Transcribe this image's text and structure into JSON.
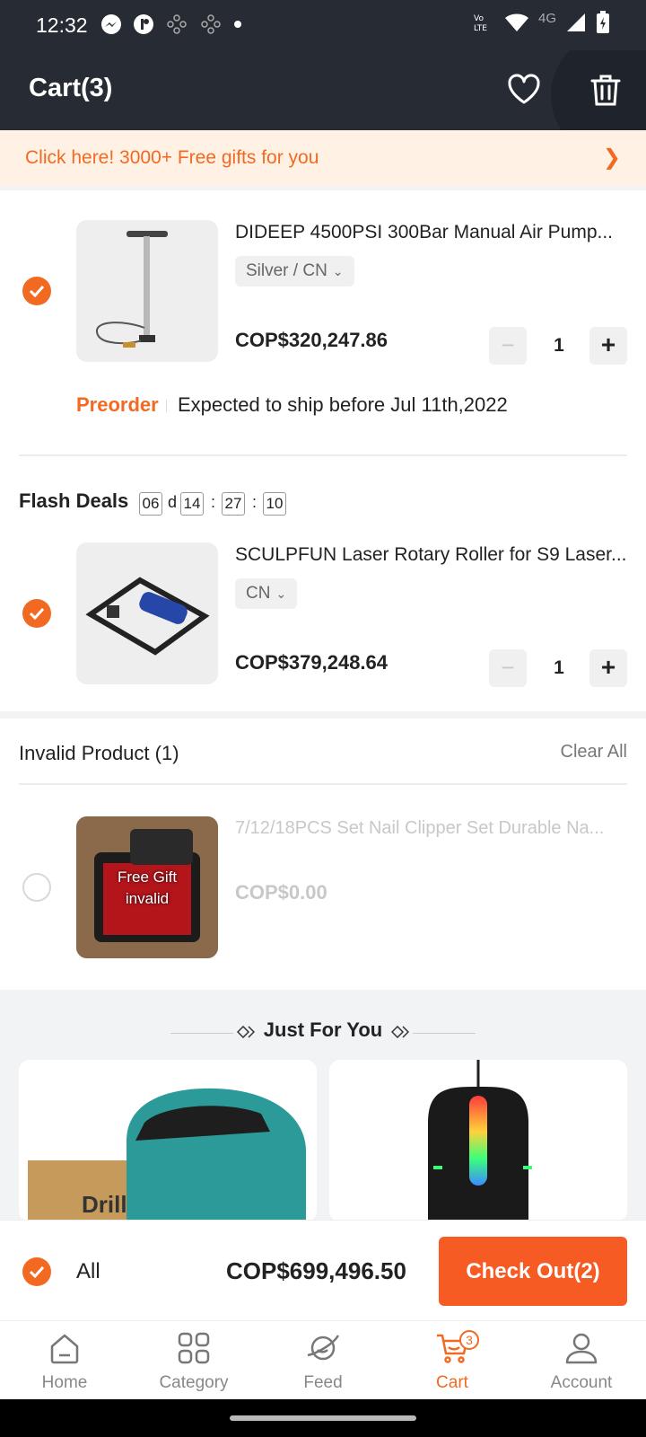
{
  "status_bar": {
    "time": "12:32",
    "network": "4G"
  },
  "header": {
    "title": "Cart(3)"
  },
  "gift_banner": {
    "text": "Click here! 3000+ Free gifts for you"
  },
  "cart_items": [
    {
      "name": "DIDEEP 4500PSI 300Bar Manual Air Pump...",
      "variant": "Silver / CN",
      "price": "COP$320,247.86",
      "qty": "1",
      "preorder_label": "Preorder",
      "ship_note": "Expected to ship before Jul 11th,2022"
    },
    {
      "name": "SCULPFUN Laser Rotary Roller for S9 Laser...",
      "variant": "CN",
      "price": "COP$379,248.64",
      "qty": "1"
    }
  ],
  "flash_deals": {
    "title": "Flash Deals",
    "days": "06",
    "d_label": "d",
    "hours": "14",
    "minutes": "27",
    "seconds": "10",
    "sep": ":"
  },
  "invalid": {
    "title": "Invalid Product (1)",
    "clear_all": "Clear All",
    "item": {
      "name": "7/12/18PCS Set Nail Clipper Set Durable Na...",
      "price": "COP$0.00",
      "overlay_line1": "Free Gift",
      "overlay_line2": "invalid"
    }
  },
  "just_for_you": {
    "title": "Just For You"
  },
  "checkout": {
    "all_label": "All",
    "total": "COP$699,496.50",
    "button": "Check Out(2)"
  },
  "tabs": [
    {
      "label": "Home",
      "icon": "home-icon"
    },
    {
      "label": "Category",
      "icon": "category-icon"
    },
    {
      "label": "Feed",
      "icon": "feed-icon"
    },
    {
      "label": "Cart",
      "icon": "cart-icon",
      "badge": "3",
      "active": true
    },
    {
      "label": "Account",
      "icon": "account-icon"
    }
  ],
  "colors": {
    "accent": "#f26a22",
    "header_bg": "#262b34",
    "checkout_button": "#f75b24"
  }
}
